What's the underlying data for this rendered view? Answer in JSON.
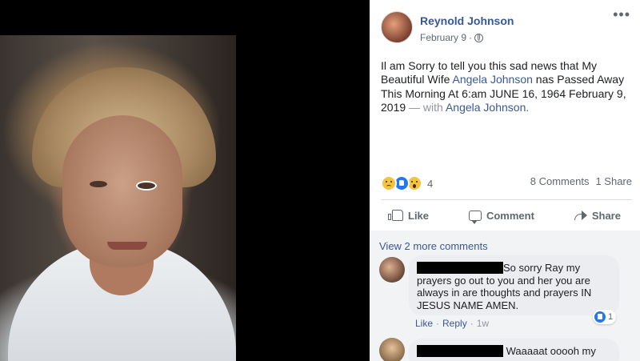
{
  "post": {
    "author": "Reynold Johnson",
    "date": "February 9",
    "date_sep": "·",
    "more_label": "•••",
    "text_part1": "Il am Sorry to tell you this sad news that My Beautiful Wife ",
    "mention1": "Angela Johnson",
    "text_part2": " nas Passed Away This Morning At 6:am JUNE 16, 1964 February 9, 2019",
    "with_label": " — with ",
    "mention2": "Angela Johnson.",
    "reaction_count": "4",
    "comments_count": "8 Comments",
    "shares_count": "1 Share"
  },
  "actions": {
    "like": "Like",
    "comment": "Comment",
    "share": "Share"
  },
  "comments": {
    "view_more": "View 2 more comments",
    "items": [
      {
        "text_line1": "So sorry Ray my",
        "text_rest": "prayers go out to you and her you are always in are thoughts and prayers IN JESUS NAME AMEN.",
        "like_action": "Like",
        "reply_action": "Reply",
        "time": "1w",
        "like_count": "1"
      },
      {
        "text_line1": "Waaaaat ooooh my"
      }
    ]
  },
  "icons": {
    "reactions": [
      "sad-reaction-icon",
      "like-reaction-icon",
      "wow-reaction-icon"
    ]
  },
  "colors": {
    "link": "#385898",
    "like_blue": "#2078f4",
    "muted": "#606770"
  }
}
